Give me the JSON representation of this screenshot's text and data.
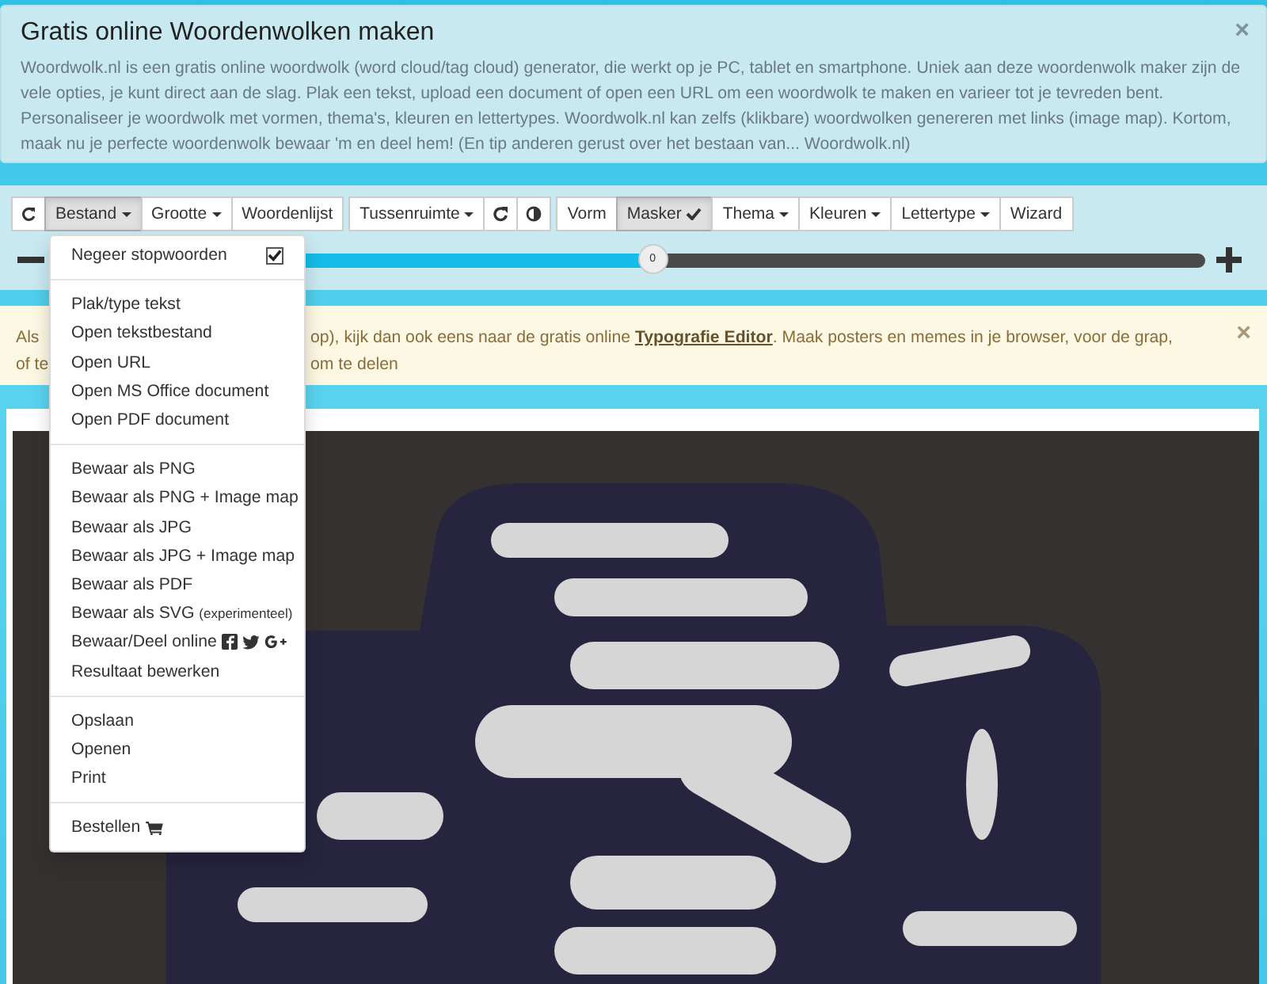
{
  "intro": {
    "title": "Gratis online Woordenwolken maken",
    "text": "Woordwolk.nl is een gratis online woordwolk (word cloud/tag cloud) generator, die werkt op je PC, tablet en smartphone. Uniek aan deze woordenwolk maker zijn de vele opties, je kunt direct aan de slag. Plak een tekst, upload een document of open een URL om een woordwolk te maken en varieer tot je tevreden bent. Personaliseer je woordwolk met vormen, thema's, kleuren en lettertypes. Woordwolk.nl kan zelfs (klikbare) woordwolken genereren met links (image map). Kortom, maak nu je perfecte woordenwolk bewaar 'm en deel hem! (En tip anderen gerust over het bestaan van... Woordwolk.nl)",
    "close": "×"
  },
  "toolbar": {
    "groups": [
      [
        {
          "kind": "refresh"
        },
        {
          "kind": "text",
          "label": "Bestand",
          "caret": true,
          "checked": false,
          "selected": true
        },
        {
          "kind": "text",
          "label": "Grootte",
          "caret": true,
          "checked": false,
          "selected": false
        },
        {
          "kind": "text",
          "label": "Woordenlijst",
          "caret": false,
          "checked": false,
          "selected": false
        }
      ],
      [
        {
          "kind": "text",
          "label": "Tussenruimte",
          "caret": true,
          "checked": false,
          "selected": false
        },
        {
          "kind": "rotate"
        },
        {
          "kind": "contrast"
        }
      ],
      [
        {
          "kind": "text",
          "label": "Vorm",
          "caret": false,
          "checked": false,
          "selected": false
        },
        {
          "kind": "text",
          "label": "Masker",
          "caret": false,
          "checked": true,
          "selected": true
        },
        {
          "kind": "text",
          "label": "Thema",
          "caret": true,
          "checked": false,
          "selected": false
        },
        {
          "kind": "text",
          "label": "Kleuren",
          "caret": true,
          "checked": false,
          "selected": false
        },
        {
          "kind": "text",
          "label": "Lettertype",
          "caret": true,
          "checked": false,
          "selected": false
        },
        {
          "kind": "text",
          "label": "Wizard",
          "caret": false,
          "checked": false,
          "selected": false
        }
      ]
    ],
    "slider": {
      "level": 0.52,
      "value": "0"
    }
  },
  "menu": {
    "sections": [
      [
        {
          "kind": "check",
          "label": "Negeer stopwoorden",
          "checked": true
        }
      ],
      [
        {
          "kind": "plain",
          "label": "Plak/type tekst"
        },
        {
          "kind": "plain",
          "label": "Open tekstbestand"
        },
        {
          "kind": "plain",
          "label": "Open URL"
        },
        {
          "kind": "plain",
          "label": "Open MS Office document"
        },
        {
          "kind": "plain",
          "label": "Open PDF document"
        }
      ],
      [
        {
          "kind": "plain",
          "label": "Bewaar als PNG"
        },
        {
          "kind": "plain",
          "label": "Bewaar als PNG + Image map"
        },
        {
          "kind": "plain",
          "label": "Bewaar als JPG"
        },
        {
          "kind": "plain",
          "label": "Bewaar als JPG + Image map"
        },
        {
          "kind": "plain",
          "label": "Bewaar als PDF"
        },
        {
          "kind": "note",
          "label": "Bewaar als SVG",
          "note": "(experimenteel)"
        },
        {
          "kind": "share",
          "label": "Bewaar/Deel online"
        },
        {
          "kind": "plain",
          "label": "Resultaat bewerken"
        }
      ],
      [
        {
          "kind": "plain",
          "label": "Opslaan"
        },
        {
          "kind": "plain",
          "label": "Openen"
        },
        {
          "kind": "plain",
          "label": "Print"
        }
      ],
      [
        {
          "kind": "cart",
          "label": "Bestellen"
        }
      ]
    ]
  },
  "alert": {
    "left": [
      "Als",
      "of te"
    ],
    "text": "op), kijk dan ook eens naar de gratis online **Typografie Editor**. Maak posters en memes in je browser, voor de grap, om te delen",
    "close": "×"
  }
}
